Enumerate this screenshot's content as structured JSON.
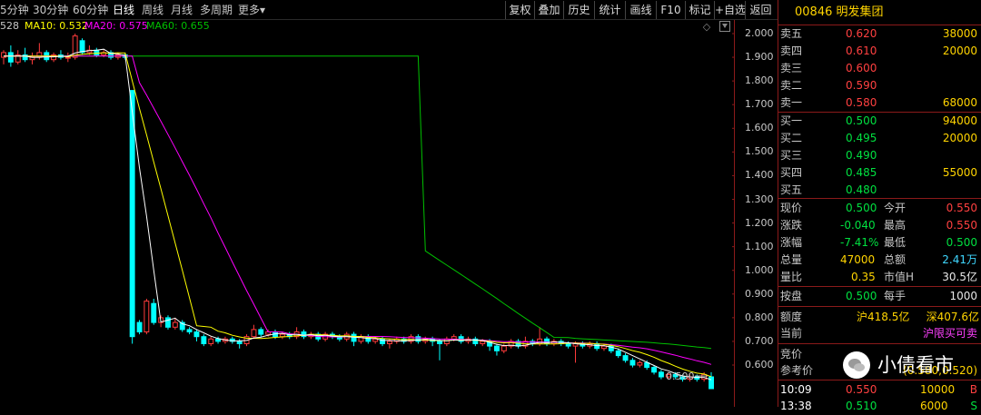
{
  "toolbar": {
    "tabs": [
      {
        "label": "5分钟",
        "active": false
      },
      {
        "label": "30分钟",
        "active": false
      },
      {
        "label": "60分钟",
        "active": false
      },
      {
        "label": "日线",
        "active": true
      },
      {
        "label": "周线",
        "active": false
      },
      {
        "label": "月线",
        "active": false
      },
      {
        "label": "多周期",
        "active": false
      },
      {
        "label": "更多▾",
        "active": false
      }
    ],
    "buttons": [
      "复权",
      "叠加",
      "历史",
      "统计",
      "画线",
      "F10",
      "标记",
      "+自选",
      "返回"
    ]
  },
  "ma_legend": {
    "price_prefix": "528",
    "ma10": "MA10: 0.532",
    "ma20": "MA20: 0.575",
    "ma60": "MA60: 0.655"
  },
  "colors": {
    "up": "#ff3b3b",
    "down": "#00ffff",
    "ma5": "#ffffff",
    "ma10": "#ffff00",
    "ma20": "#ff00ff",
    "ma60": "#00c000",
    "quote_red": "#ff4040",
    "quote_green": "#00e040",
    "quote_yellow": "#ffd400",
    "axis": "#8b1a1a"
  },
  "chart_data": {
    "type": "candlestick",
    "yaxis_ticks": [
      "2.000",
      "1.900",
      "1.800",
      "1.700",
      "1.600",
      "1.500",
      "1.400",
      "1.300",
      "1.200",
      "1.100",
      "1.000",
      "0.900",
      "0.800",
      "0.700",
      "0.600"
    ],
    "ylim": [
      0.5,
      2.05
    ],
    "low_marker": "0.500",
    "candles": [
      {
        "o": 1.9,
        "c": 1.92,
        "h": 1.93,
        "l": 1.87
      },
      {
        "o": 1.92,
        "c": 1.88,
        "h": 1.95,
        "l": 1.86
      },
      {
        "o": 1.88,
        "c": 1.91,
        "h": 1.93,
        "l": 1.87
      },
      {
        "o": 1.91,
        "c": 1.89,
        "h": 1.94,
        "l": 1.88
      },
      {
        "o": 1.89,
        "c": 1.9,
        "h": 1.92,
        "l": 1.87
      },
      {
        "o": 1.9,
        "c": 1.92,
        "h": 1.96,
        "l": 1.89
      },
      {
        "o": 1.92,
        "c": 1.89,
        "h": 1.93,
        "l": 1.88
      },
      {
        "o": 1.89,
        "c": 1.91,
        "h": 1.92,
        "l": 1.88
      },
      {
        "o": 1.91,
        "c": 1.9,
        "h": 1.93,
        "l": 1.89
      },
      {
        "o": 1.9,
        "c": 1.9,
        "h": 1.92,
        "l": 1.88
      },
      {
        "o": 1.9,
        "c": 1.99,
        "h": 2.0,
        "l": 1.89
      },
      {
        "o": 1.97,
        "c": 1.92,
        "h": 1.98,
        "l": 1.91
      },
      {
        "o": 1.92,
        "c": 1.93,
        "h": 1.95,
        "l": 1.91
      },
      {
        "o": 1.93,
        "c": 1.91,
        "h": 1.94,
        "l": 1.9
      },
      {
        "o": 1.91,
        "c": 1.92,
        "h": 1.93,
        "l": 1.9
      },
      {
        "o": 1.92,
        "c": 1.9,
        "h": 1.93,
        "l": 1.89
      },
      {
        "o": 1.9,
        "c": 1.91,
        "h": 1.92,
        "l": 1.89
      },
      {
        "o": 1.91,
        "c": 1.9,
        "h": 1.92,
        "l": 1.89
      },
      {
        "o": 1.76,
        "c": 0.72,
        "h": 1.76,
        "l": 0.69
      },
      {
        "o": 0.78,
        "c": 0.74,
        "h": 0.79,
        "l": 0.73
      },
      {
        "o": 0.74,
        "c": 0.87,
        "h": 0.88,
        "l": 0.73
      },
      {
        "o": 0.86,
        "c": 0.78,
        "h": 0.88,
        "l": 0.77
      },
      {
        "o": 0.78,
        "c": 0.8,
        "h": 0.81,
        "l": 0.76
      },
      {
        "o": 0.8,
        "c": 0.76,
        "h": 0.81,
        "l": 0.75
      },
      {
        "o": 0.76,
        "c": 0.78,
        "h": 0.8,
        "l": 0.75
      },
      {
        "o": 0.78,
        "c": 0.75,
        "h": 0.79,
        "l": 0.74
      },
      {
        "o": 0.75,
        "c": 0.74,
        "h": 0.76,
        "l": 0.73
      },
      {
        "o": 0.74,
        "c": 0.72,
        "h": 0.75,
        "l": 0.7
      },
      {
        "o": 0.72,
        "c": 0.69,
        "h": 0.73,
        "l": 0.68
      },
      {
        "o": 0.69,
        "c": 0.71,
        "h": 0.72,
        "l": 0.68
      },
      {
        "o": 0.71,
        "c": 0.7,
        "h": 0.72,
        "l": 0.69
      },
      {
        "o": 0.7,
        "c": 0.71,
        "h": 0.72,
        "l": 0.69
      },
      {
        "o": 0.71,
        "c": 0.7,
        "h": 0.72,
        "l": 0.69
      },
      {
        "o": 0.7,
        "c": 0.69,
        "h": 0.71,
        "l": 0.67
      },
      {
        "o": 0.69,
        "c": 0.72,
        "h": 0.73,
        "l": 0.68
      },
      {
        "o": 0.72,
        "c": 0.75,
        "h": 0.77,
        "l": 0.71
      },
      {
        "o": 0.75,
        "c": 0.73,
        "h": 0.76,
        "l": 0.72
      },
      {
        "o": 0.73,
        "c": 0.74,
        "h": 0.75,
        "l": 0.72
      },
      {
        "o": 0.74,
        "c": 0.72,
        "h": 0.75,
        "l": 0.71
      },
      {
        "o": 0.72,
        "c": 0.73,
        "h": 0.74,
        "l": 0.71
      },
      {
        "o": 0.73,
        "c": 0.72,
        "h": 0.74,
        "l": 0.71
      },
      {
        "o": 0.72,
        "c": 0.74,
        "h": 0.76,
        "l": 0.71
      },
      {
        "o": 0.74,
        "c": 0.72,
        "h": 0.75,
        "l": 0.71
      },
      {
        "o": 0.72,
        "c": 0.73,
        "h": 0.74,
        "l": 0.71
      },
      {
        "o": 0.73,
        "c": 0.71,
        "h": 0.74,
        "l": 0.7
      },
      {
        "o": 0.71,
        "c": 0.73,
        "h": 0.74,
        "l": 0.7
      },
      {
        "o": 0.73,
        "c": 0.72,
        "h": 0.74,
        "l": 0.71
      },
      {
        "o": 0.72,
        "c": 0.71,
        "h": 0.73,
        "l": 0.7
      },
      {
        "o": 0.71,
        "c": 0.73,
        "h": 0.74,
        "l": 0.7
      },
      {
        "o": 0.73,
        "c": 0.7,
        "h": 0.74,
        "l": 0.68
      },
      {
        "o": 0.7,
        "c": 0.72,
        "h": 0.73,
        "l": 0.69
      },
      {
        "o": 0.72,
        "c": 0.7,
        "h": 0.73,
        "l": 0.69
      },
      {
        "o": 0.7,
        "c": 0.71,
        "h": 0.72,
        "l": 0.69
      },
      {
        "o": 0.71,
        "c": 0.69,
        "h": 0.72,
        "l": 0.68
      },
      {
        "o": 0.69,
        "c": 0.7,
        "h": 0.71,
        "l": 0.67
      },
      {
        "o": 0.7,
        "c": 0.71,
        "h": 0.72,
        "l": 0.69
      },
      {
        "o": 0.71,
        "c": 0.7,
        "h": 0.72,
        "l": 0.69
      },
      {
        "o": 0.7,
        "c": 0.72,
        "h": 0.73,
        "l": 0.69
      },
      {
        "o": 0.72,
        "c": 0.7,
        "h": 0.73,
        "l": 0.69
      },
      {
        "o": 0.7,
        "c": 0.71,
        "h": 0.72,
        "l": 0.69
      },
      {
        "o": 0.71,
        "c": 0.7,
        "h": 0.72,
        "l": 0.68
      },
      {
        "o": 0.7,
        "c": 0.69,
        "h": 0.71,
        "l": 0.62
      },
      {
        "o": 0.69,
        "c": 0.71,
        "h": 0.72,
        "l": 0.68
      },
      {
        "o": 0.71,
        "c": 0.72,
        "h": 0.73,
        "l": 0.7
      },
      {
        "o": 0.72,
        "c": 0.7,
        "h": 0.73,
        "l": 0.69
      },
      {
        "o": 0.7,
        "c": 0.71,
        "h": 0.72,
        "l": 0.69
      },
      {
        "o": 0.71,
        "c": 0.69,
        "h": 0.72,
        "l": 0.68
      },
      {
        "o": 0.69,
        "c": 0.7,
        "h": 0.71,
        "l": 0.68
      },
      {
        "o": 0.7,
        "c": 0.68,
        "h": 0.71,
        "l": 0.66
      },
      {
        "o": 0.68,
        "c": 0.66,
        "h": 0.69,
        "l": 0.64
      },
      {
        "o": 0.66,
        "c": 0.68,
        "h": 0.69,
        "l": 0.65
      },
      {
        "o": 0.68,
        "c": 0.7,
        "h": 0.71,
        "l": 0.67
      },
      {
        "o": 0.7,
        "c": 0.68,
        "h": 0.71,
        "l": 0.67
      },
      {
        "o": 0.68,
        "c": 0.7,
        "h": 0.72,
        "l": 0.67
      },
      {
        "o": 0.7,
        "c": 0.69,
        "h": 0.71,
        "l": 0.68
      },
      {
        "o": 0.69,
        "c": 0.71,
        "h": 0.76,
        "l": 0.68
      },
      {
        "o": 0.71,
        "c": 0.69,
        "h": 0.72,
        "l": 0.68
      },
      {
        "o": 0.69,
        "c": 0.7,
        "h": 0.71,
        "l": 0.68
      },
      {
        "o": 0.7,
        "c": 0.69,
        "h": 0.71,
        "l": 0.68
      },
      {
        "o": 0.69,
        "c": 0.68,
        "h": 0.7,
        "l": 0.67
      },
      {
        "o": 0.68,
        "c": 0.69,
        "h": 0.7,
        "l": 0.61
      },
      {
        "o": 0.69,
        "c": 0.68,
        "h": 0.7,
        "l": 0.67
      },
      {
        "o": 0.68,
        "c": 0.69,
        "h": 0.7,
        "l": 0.67
      },
      {
        "o": 0.69,
        "c": 0.67,
        "h": 0.7,
        "l": 0.66
      },
      {
        "o": 0.67,
        "c": 0.68,
        "h": 0.69,
        "l": 0.66
      },
      {
        "o": 0.68,
        "c": 0.66,
        "h": 0.69,
        "l": 0.65
      },
      {
        "o": 0.66,
        "c": 0.64,
        "h": 0.67,
        "l": 0.63
      },
      {
        "o": 0.64,
        "c": 0.62,
        "h": 0.65,
        "l": 0.61
      },
      {
        "o": 0.62,
        "c": 0.6,
        "h": 0.63,
        "l": 0.59
      },
      {
        "o": 0.6,
        "c": 0.61,
        "h": 0.62,
        "l": 0.59
      },
      {
        "o": 0.61,
        "c": 0.59,
        "h": 0.62,
        "l": 0.58
      },
      {
        "o": 0.59,
        "c": 0.57,
        "h": 0.6,
        "l": 0.56
      },
      {
        "o": 0.57,
        "c": 0.55,
        "h": 0.58,
        "l": 0.54
      },
      {
        "o": 0.55,
        "c": 0.56,
        "h": 0.57,
        "l": 0.54
      },
      {
        "o": 0.56,
        "c": 0.55,
        "h": 0.57,
        "l": 0.54
      },
      {
        "o": 0.55,
        "c": 0.54,
        "h": 0.56,
        "l": 0.53
      },
      {
        "o": 0.54,
        "c": 0.55,
        "h": 0.56,
        "l": 0.53
      },
      {
        "o": 0.55,
        "c": 0.54,
        "h": 0.56,
        "l": 0.53
      },
      {
        "o": 0.54,
        "c": 0.56,
        "h": 0.57,
        "l": 0.53
      },
      {
        "o": 0.55,
        "c": 0.5,
        "h": 0.57,
        "l": 0.5
      }
    ]
  },
  "quote": {
    "code_name": "00846 明发集团",
    "asks": [
      {
        "label": "卖五",
        "price": "0.620",
        "vol": "38000"
      },
      {
        "label": "卖四",
        "price": "0.610",
        "vol": "20000"
      },
      {
        "label": "卖三",
        "price": "0.600",
        "vol": ""
      },
      {
        "label": "卖二",
        "price": "0.590",
        "vol": ""
      },
      {
        "label": "卖一",
        "price": "0.580",
        "vol": "68000"
      }
    ],
    "bids": [
      {
        "label": "买一",
        "price": "0.500",
        "vol": "94000"
      },
      {
        "label": "买二",
        "price": "0.495",
        "vol": "20000"
      },
      {
        "label": "买三",
        "price": "0.490",
        "vol": ""
      },
      {
        "label": "买四",
        "price": "0.485",
        "vol": "55000"
      },
      {
        "label": "买五",
        "price": "0.480",
        "vol": ""
      }
    ],
    "stats": {
      "now_label": "现价",
      "now": "0.500",
      "open_label": "今开",
      "open": "0.550",
      "chg_label": "涨跌",
      "chg": "-0.040",
      "high_label": "最高",
      "high": "0.550",
      "pct_label": "涨幅",
      "pct": "-7.41%",
      "low_label": "最低",
      "low": "0.500",
      "vol_label": "总量",
      "vol": "47000",
      "amt_label": "总额",
      "amt": "2.41万",
      "vr_label": "量比",
      "vr": "0.35",
      "mcap_label": "市值H",
      "mcap": "30.5亿"
    },
    "close_auction": {
      "label": "按盘",
      "value": "0.500",
      "lot_label": "每手",
      "lot": "1000"
    },
    "quota": {
      "label": "额度",
      "sh": "沪418.5亿",
      "sz": "深407.6亿"
    },
    "current": {
      "label": "当前",
      "value": "沪限买可卖"
    },
    "auction": {
      "label1": "竞价",
      "label2": "参考价",
      "value": "(0.580,0.520)"
    },
    "ticks": [
      {
        "time": "10:09",
        "price": "0.550",
        "vol": "10000",
        "side": "B"
      },
      {
        "time": "13:38",
        "price": "0.510",
        "vol": "6000",
        "side": "S"
      }
    ]
  },
  "watermark": {
    "text": "小债看市"
  }
}
